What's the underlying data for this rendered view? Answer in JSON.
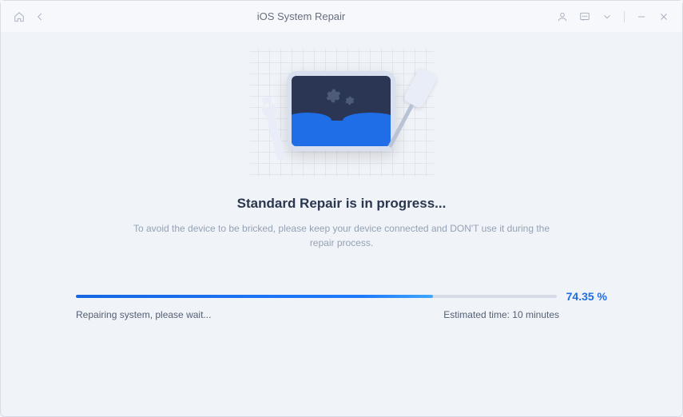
{
  "titlebar": {
    "title": "iOS System Repair"
  },
  "main": {
    "heading": "Standard Repair is in progress...",
    "subtext": "To avoid the device to be bricked, please keep your device connected and DON'T use it during the repair process.",
    "progress": {
      "percent_value": 74.35,
      "percent_label": "74.35 %",
      "status_text": "Repairing system, please wait...",
      "eta_text": "Estimated time: 10 minutes",
      "bar_width": "74.35%"
    }
  }
}
